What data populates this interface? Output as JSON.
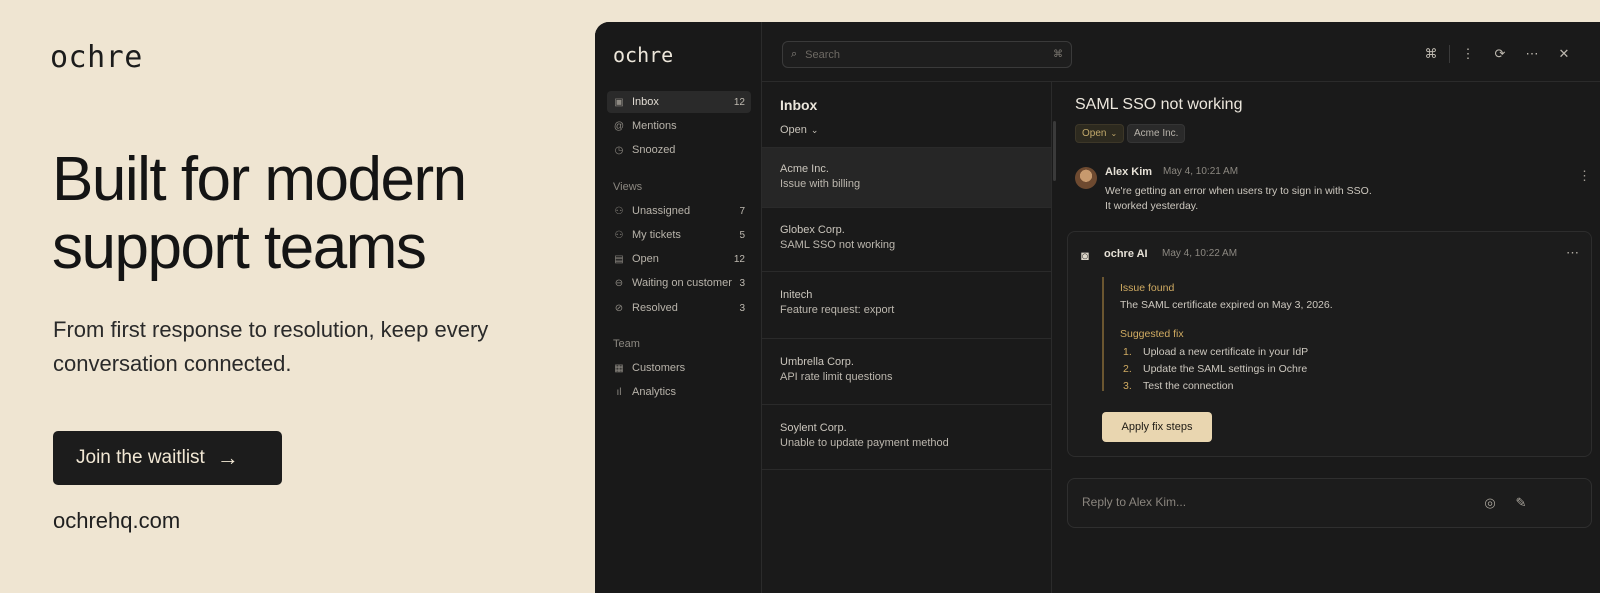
{
  "marketing": {
    "brand": "ochre",
    "headline": "Built for modern support teams",
    "subhead": "From first response to resolution, keep every conversation connected.",
    "cta_label": "Join the waitlist",
    "cta_arrow": "→",
    "website": "ochrehq.com"
  },
  "app": {
    "logo": "ochre",
    "search": {
      "placeholder": "Search",
      "shortcut": "⌘"
    },
    "nav": {
      "inbox": {
        "label": "Inbox",
        "count": "12"
      },
      "mentions": {
        "label": "Mentions"
      },
      "snoozed": {
        "label": "Snoozed"
      }
    },
    "views_label": "Views",
    "views": [
      {
        "label": "Unassigned",
        "count": "7"
      },
      {
        "label": "My tickets",
        "count": "5"
      },
      {
        "label": "Open",
        "count": "12"
      },
      {
        "label": "Waiting on customer",
        "count": "3"
      },
      {
        "label": "Resolved",
        "count": "3"
      }
    ],
    "team_label": "Team",
    "team": [
      {
        "label": "Customers"
      },
      {
        "label": "Analytics"
      }
    ],
    "list": {
      "title": "Inbox",
      "filter": "Open",
      "tickets": [
        {
          "company": "Acme Inc.",
          "subject": "Issue with billing"
        },
        {
          "company": "Globex Corp.",
          "subject": "SAML SSO not working"
        },
        {
          "company": "Initech",
          "subject": "Feature request: export"
        },
        {
          "company": "Umbrella Corp.",
          "subject": "API rate limit questions"
        },
        {
          "company": "Soylent Corp.",
          "subject": "Unable to update payment method"
        }
      ]
    },
    "detail": {
      "title": "SAML SSO not working",
      "status_tag": "Open",
      "org_tag": "Acme Inc.",
      "message": {
        "author": "Alex Kim",
        "time": "May 4, 10:21 AM",
        "line1": "We're getting an error when users try to sign in with SSO.",
        "line2": "It worked yesterday."
      },
      "ai": {
        "author": "ochre AI",
        "time": "May 4, 10:22 AM",
        "issue_heading": "Issue found",
        "issue_text": "The SAML certificate expired on May 3, 2026.",
        "fix_heading": "Suggested fix",
        "steps": [
          {
            "n": "1.",
            "text": "Upload a new certificate in your IdP"
          },
          {
            "n": "2.",
            "text": "Update the SAML settings in Ochre"
          },
          {
            "n": "3.",
            "text": "Test the connection"
          }
        ],
        "apply_label": "Apply fix steps"
      },
      "reply_placeholder": "Reply to Alex Kim..."
    }
  },
  "colors": {
    "page_bg": "#efe5d2",
    "app_bg": "#1a1a1a",
    "accent": "#d0ab62",
    "cta_bg": "#1c1c1c",
    "apply_bg": "#e9d6b0"
  }
}
